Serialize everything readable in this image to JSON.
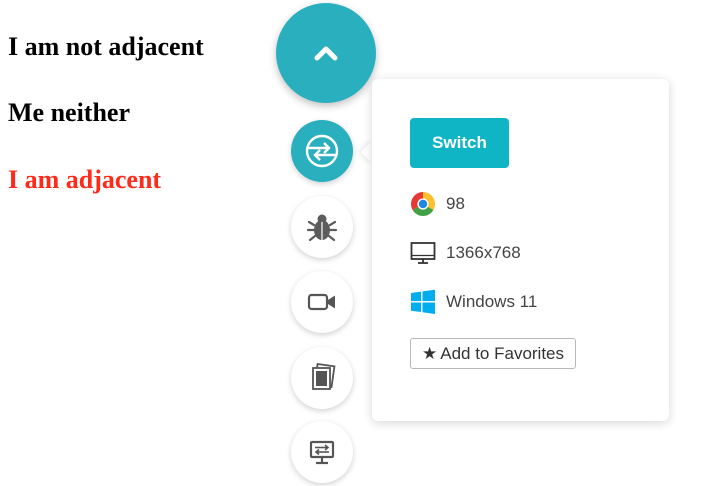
{
  "headings": [
    {
      "text": "I am not adjacent",
      "color": "#000000"
    },
    {
      "text": "Me neither",
      "color": "#000000"
    },
    {
      "text": "I am adjacent",
      "color": "#ff2a1a"
    }
  ],
  "toolbar": {
    "main_button_icon": "chevron-up-icon",
    "tools": [
      {
        "name": "switch-browser",
        "icon": "switch-arrows-icon",
        "active": true
      },
      {
        "name": "bug-report",
        "icon": "bug-icon",
        "active": false
      },
      {
        "name": "record-video",
        "icon": "video-camera-icon",
        "active": false
      },
      {
        "name": "screenshot-gallery",
        "icon": "gallery-icon",
        "active": false
      },
      {
        "name": "remote-desktop",
        "icon": "monitor-transfer-icon",
        "active": false
      }
    ]
  },
  "panel": {
    "switch_label": "Switch",
    "browser_version": "98",
    "resolution": "1366x768",
    "os": "Windows 11",
    "favorites_label": "Add to Favorites"
  },
  "colors": {
    "accent": "#2aafbf",
    "button": "#0fb5c4",
    "windows_blue": "#00adef"
  }
}
